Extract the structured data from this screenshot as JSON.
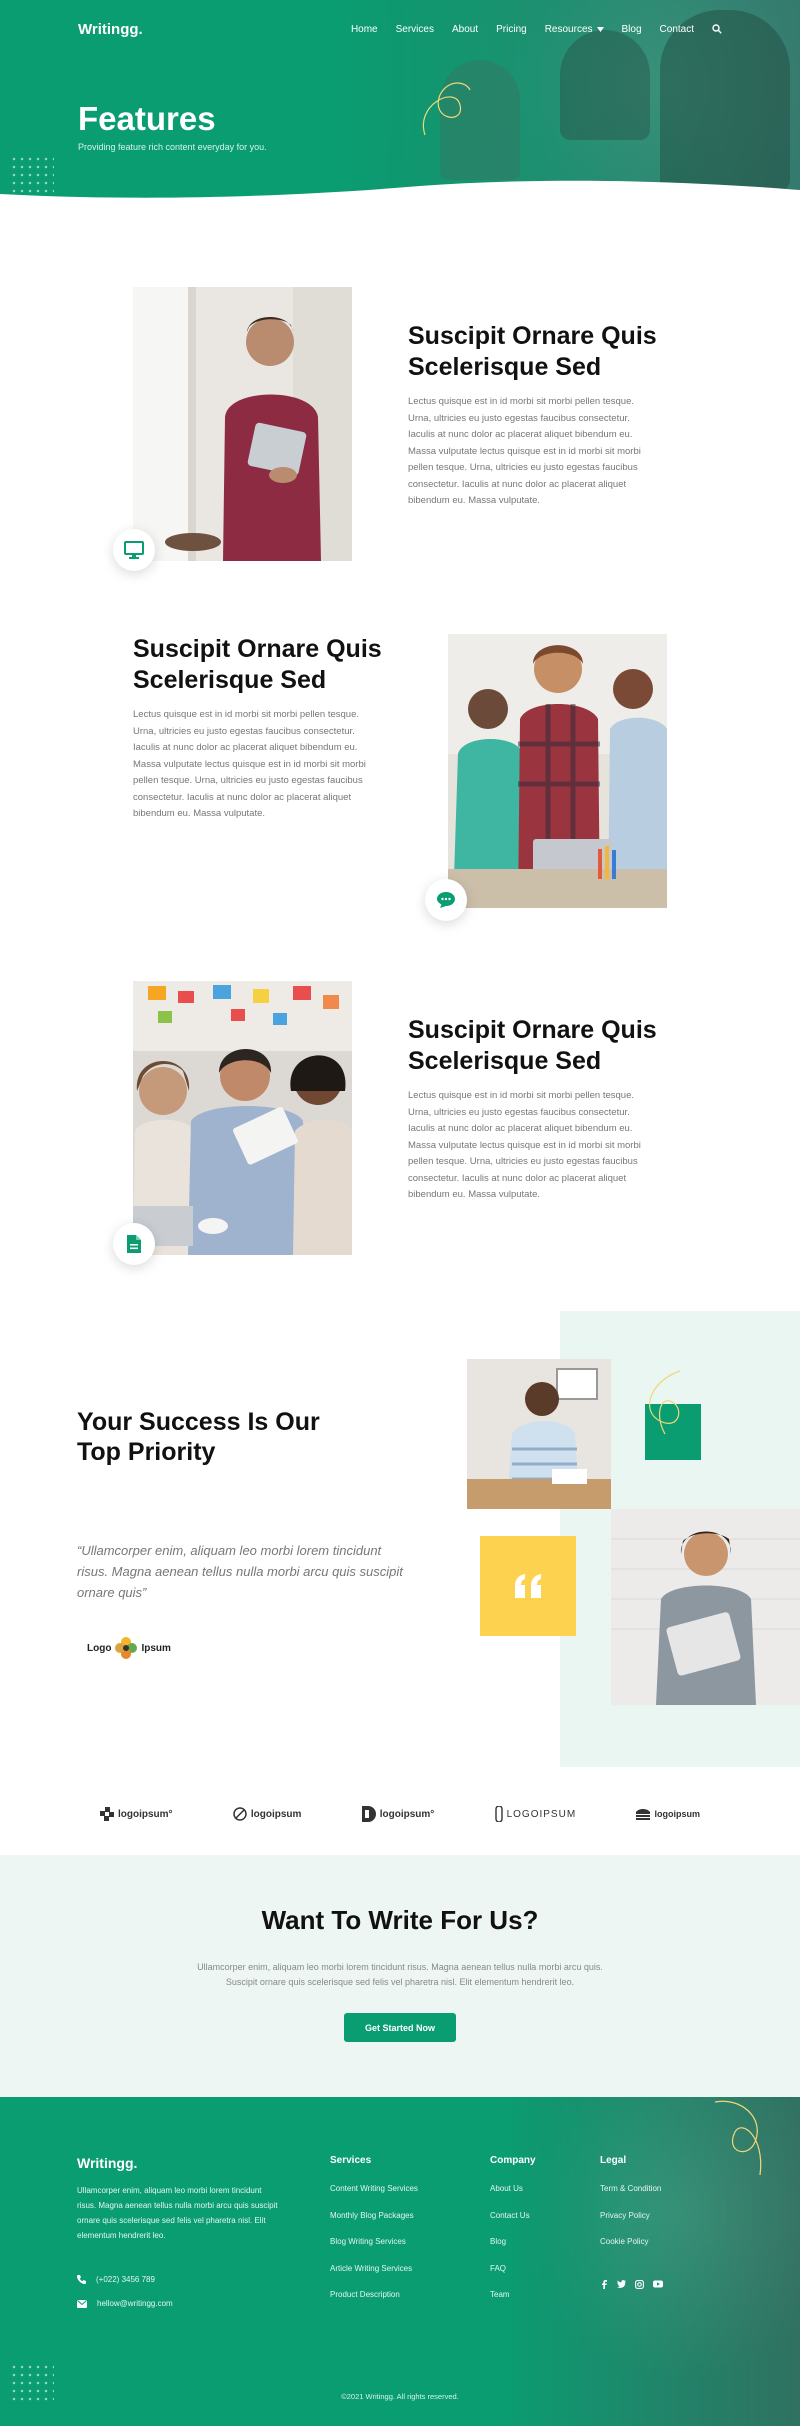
{
  "site": {
    "logo": "Writingg."
  },
  "nav": {
    "items": [
      "Home",
      "Services",
      "About",
      "Pricing",
      "Resources",
      "Blog",
      "Contact"
    ]
  },
  "hero": {
    "title": "Features",
    "subtitle": "Providing feature rich content everyday for you."
  },
  "features": [
    {
      "title": "Suscipit Ornare Quis Scelerisque Sed",
      "text": "Lectus quisque est in id morbi sit morbi pellen tesque. Urna, ultricies eu justo egestas faucibus consectetur. Iaculis at nunc dolor ac placerat aliquet bibendum eu. Massa vulputate lectus quisque est in id morbi sit morbi pellen tesque. Urna, ultricies eu justo egestas faucibus consectetur. Iaculis at nunc dolor ac placerat aliquet bibendum eu. Massa vulputate.",
      "icon": "monitor-icon"
    },
    {
      "title": "Suscipit Ornare Quis Scelerisque Sed",
      "text": "Lectus quisque est in id morbi sit morbi pellen tesque. Urna, ultricies eu justo egestas faucibus consectetur. Iaculis at nunc dolor ac placerat aliquet bibendum eu. Massa vulputate lectus quisque est in id morbi sit morbi pellen tesque. Urna, ultricies eu justo egestas faucibus consectetur. Iaculis at nunc dolor ac placerat aliquet bibendum eu. Massa vulputate.",
      "icon": "chat-bubble-icon"
    },
    {
      "title": "Suscipit Ornare Quis Scelerisque Sed",
      "text": "Lectus quisque est in id morbi sit morbi pellen tesque. Urna, ultricies eu justo egestas faucibus consectetur. Iaculis at nunc dolor ac placerat aliquet bibendum eu. Massa vulputate lectus quisque est in id morbi sit morbi pellen tesque. Urna, ultricies eu justo egestas faucibus consectetur. Iaculis at nunc dolor ac placerat aliquet bibendum eu. Massa vulputate.",
      "icon": "document-icon"
    }
  ],
  "success": {
    "title": "Your Success Is Our Top Priority",
    "quote": "“Ullamcorper enim, aliquam leo morbi lorem tincidunt risus. Magna aenean tellus nulla morbi arcu quis suscipit ornare quis”",
    "logo_left": "Logo",
    "logo_right": "Ipsum"
  },
  "brands": [
    "logoipsum°",
    "logoipsum",
    "logoipsum°",
    "LOGOIPSUM",
    "logoipsum"
  ],
  "cta": {
    "title": "Want To Write For Us?",
    "text": "Ullamcorper enim, aliquam leo morbi lorem tincidunt risus. Magna aenean tellus nulla morbi arcu quis. Suscipit ornare quis scelerisque sed felis vel pharetra nisl. Elit elementum hendrerit leo.",
    "button": "Get Started Now"
  },
  "footer": {
    "logo": "Writingg.",
    "about": "Ullamcorper enim, aliquam leo morbi lorem tincidunt risus. Magna aenean tellus nulla morbi arcu quis suscipit ornare quis scelerisque sed felis vel pharetra nisl. Elit elementum hendrerit leo.",
    "phone": "(+022) 3456 789",
    "email": "hellow@writingg.com",
    "columns": [
      {
        "title": "Services",
        "links": [
          "Content Writing Services",
          "Monthly Blog Packages",
          "Blog Writing Services",
          "Article Writing Services",
          "Product Description"
        ]
      },
      {
        "title": "Company",
        "links": [
          "About Us",
          "Contact Us",
          "Blog",
          "FAQ",
          "Team"
        ]
      },
      {
        "title": "Legal",
        "links": [
          "Term & Condition",
          "Privacy Policy",
          "Cookie Policy"
        ]
      }
    ],
    "copyright": "©2021 Writingg. All rights reserved."
  },
  "colors": {
    "primary": "#0a9d72",
    "accent_yellow": "#fcd24f",
    "mint": "#e9f6f1"
  }
}
